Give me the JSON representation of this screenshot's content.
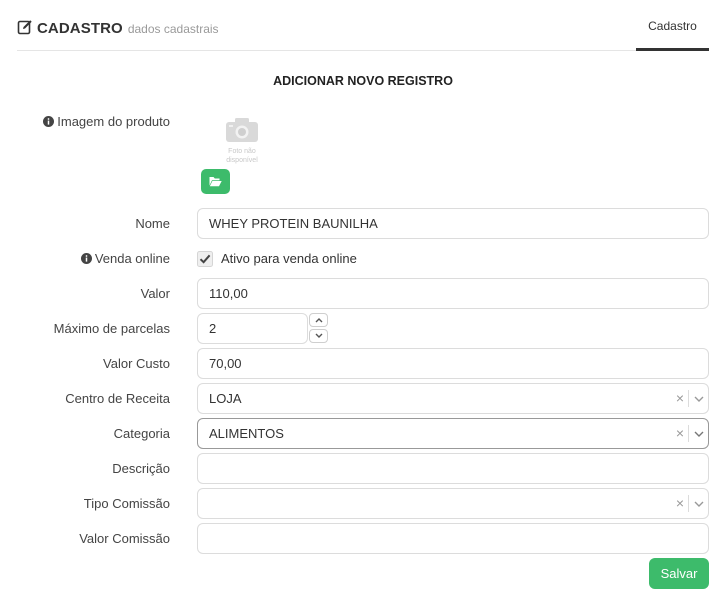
{
  "header": {
    "title": "CADASTRO",
    "subtitle": "dados cadastrais",
    "tab": "Cadastro"
  },
  "form": {
    "title": "ADICIONAR NOVO REGISTRO",
    "image_label": "Imagem do produto",
    "photo_placeholder_line1": "Foto não",
    "photo_placeholder_line2": "disponível",
    "nome": {
      "label": "Nome",
      "value": "WHEY PROTEIN BAUNILHA"
    },
    "venda_online": {
      "label": "Venda online",
      "checkbox_label": "Ativo para venda online",
      "checked": true
    },
    "valor": {
      "label": "Valor",
      "value": "110,00"
    },
    "max_parcelas": {
      "label": "Máximo de parcelas",
      "value": "2"
    },
    "valor_custo": {
      "label": "Valor Custo",
      "value": "70,00"
    },
    "centro_receita": {
      "label": "Centro de Receita",
      "value": "LOJA"
    },
    "categoria": {
      "label": "Categoria",
      "value": "ALIMENTOS"
    },
    "descricao": {
      "label": "Descrição",
      "value": ""
    },
    "tipo_comissao": {
      "label": "Tipo Comissão",
      "value": ""
    },
    "valor_comissao": {
      "label": "Valor Comissão",
      "value": ""
    },
    "clear_symbol": "×",
    "save_label": "Salvar"
  },
  "colors": {
    "accent_green": "#3dbb6b",
    "text": "#333333",
    "muted": "#9a9a9a",
    "border": "#dcdcdc"
  },
  "icons": [
    "edit-icon",
    "info-icon",
    "camera-icon",
    "folder-open-icon",
    "check-icon",
    "chevron-up-icon",
    "chevron-down-icon",
    "clear-icon"
  ]
}
